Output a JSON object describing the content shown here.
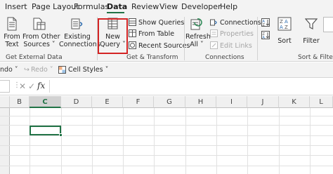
{
  "tabs": {
    "items": [
      "Insert",
      "Page Layout",
      "Formulas",
      "Data",
      "Review",
      "View",
      "Developer",
      "Help"
    ],
    "active": "Data"
  },
  "ribbon": {
    "get_external_data": {
      "from_text": [
        "From",
        "Text"
      ],
      "from_other_sources": [
        "From Other",
        "Sources ˅"
      ],
      "existing_connections": [
        "Existing",
        "Connections"
      ],
      "group_label": "Get External Data"
    },
    "get_transform": {
      "new_query": [
        "New",
        "Query ˅"
      ],
      "show_queries": "Show Queries",
      "from_table": "From Table",
      "recent_sources": "Recent Sources",
      "group_label": "Get & Transform"
    },
    "connections": {
      "refresh_all": [
        "Refresh",
        "All ˅"
      ],
      "connections": "Connections",
      "properties": "Properties",
      "edit_links": "Edit Links",
      "group_label": "Connections"
    },
    "sort_filter": {
      "sort": "Sort",
      "filter": "Filter",
      "group_label": "Sort & Filter"
    }
  },
  "qat": {
    "undo": "ndo ˅",
    "redo": "Redo ˅",
    "cell_styles": "Cell Styles ˅"
  },
  "formula_bar": {
    "fx": "fx",
    "cancel": "✕",
    "enter": "✓"
  },
  "grid": {
    "columns": [
      "B",
      "C",
      "D",
      "E",
      "F",
      "G",
      "H",
      "I",
      "J",
      "K",
      "L"
    ],
    "active_column": "C"
  },
  "colors": {
    "accent": "#217346",
    "highlight": "#d42424"
  }
}
